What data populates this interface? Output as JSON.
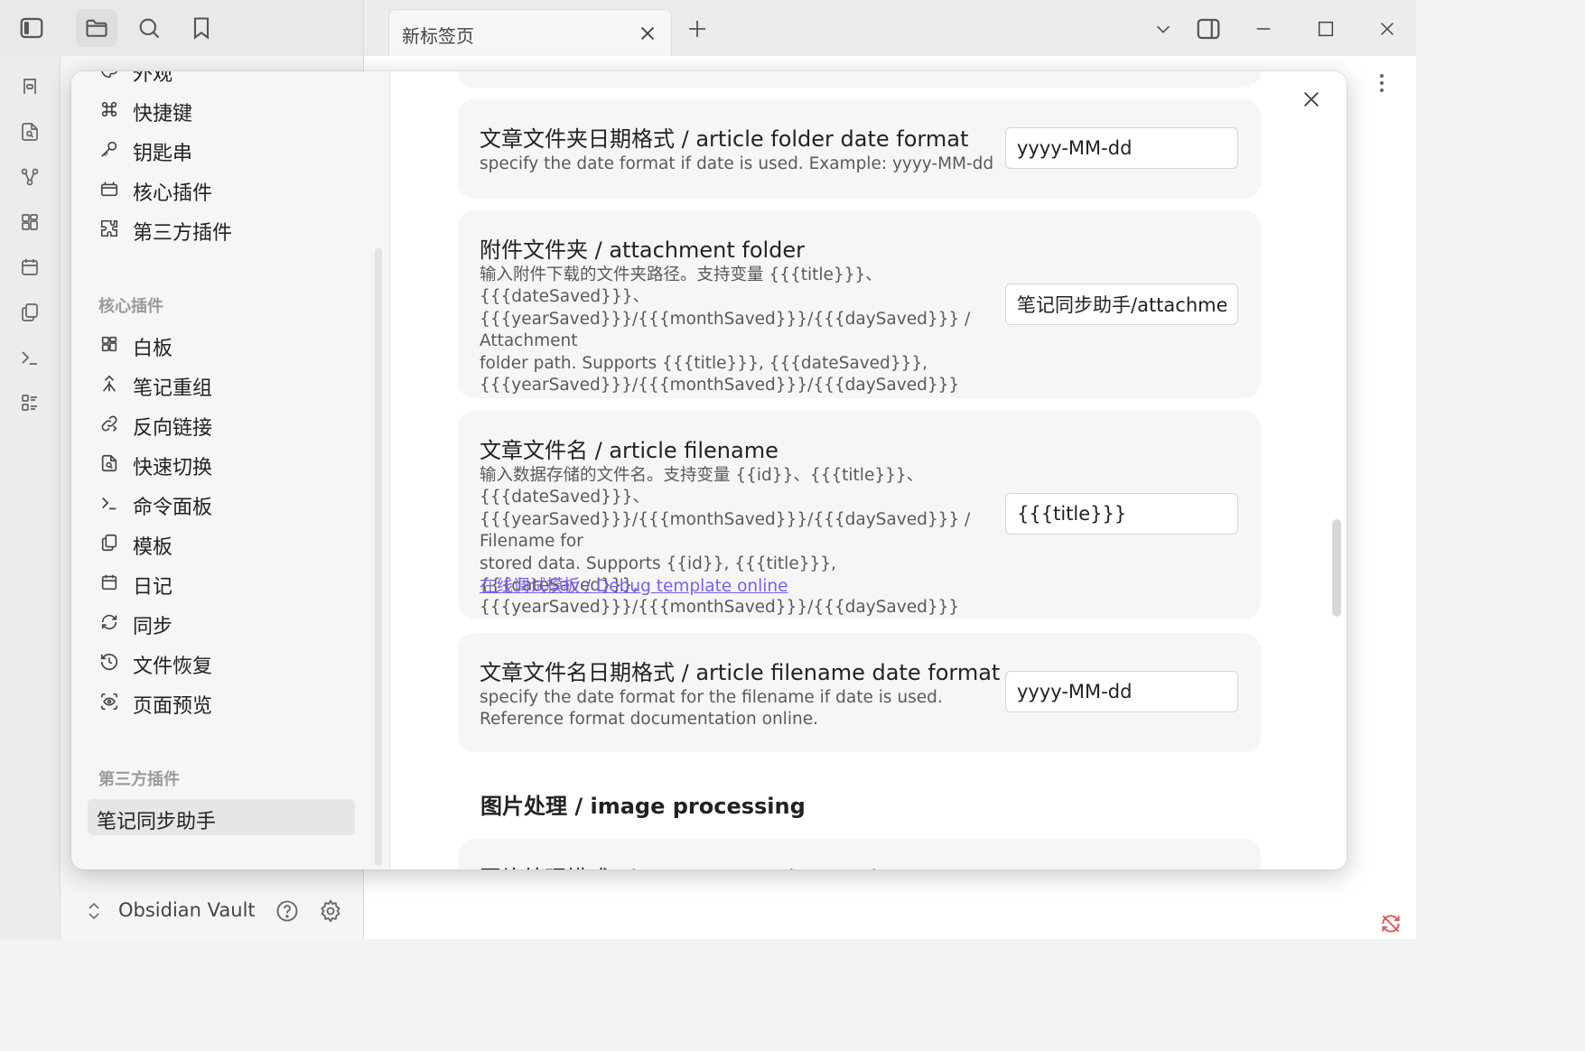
{
  "titlebar": {
    "tab_title": "新标签页"
  },
  "vault": {
    "name": "Obsidian Vault"
  },
  "settings_nav": {
    "top_items": [
      {
        "label": "外观",
        "icon": "palette-icon"
      },
      {
        "label": "快捷键",
        "icon": "command-icon"
      },
      {
        "label": "钥匙串",
        "icon": "key-icon"
      },
      {
        "label": "核心插件",
        "icon": "plug-icon"
      },
      {
        "label": "第三方插件",
        "icon": "puzzle-icon"
      }
    ],
    "core_heading": "核心插件",
    "core_items": [
      {
        "label": "白板",
        "icon": "canvas-icon"
      },
      {
        "label": "笔记重组",
        "icon": "merge-icon"
      },
      {
        "label": "反向链接",
        "icon": "backlink-icon"
      },
      {
        "label": "快速切换",
        "icon": "file-search-icon"
      },
      {
        "label": "命令面板",
        "icon": "terminal-icon"
      },
      {
        "label": "模板",
        "icon": "copy-icon"
      },
      {
        "label": "日记",
        "icon": "calendar-icon"
      },
      {
        "label": "同步",
        "icon": "refresh-icon"
      },
      {
        "label": "文件恢复",
        "icon": "history-icon"
      },
      {
        "label": "页面预览",
        "icon": "eye-scan-icon"
      }
    ],
    "community_heading": "第三方插件",
    "community_items": [
      {
        "label": "笔记同步助手",
        "active": true
      }
    ]
  },
  "settings": {
    "folder_date_format": {
      "title": "文章文件夹日期格式 / article folder date format",
      "desc": "specify the date format if date is used. Example: yyyy-MM-dd",
      "value": "yyyy-MM-dd"
    },
    "attachment_folder": {
      "title": "附件文件夹 / attachment folder",
      "desc_lines": [
        "输入附件下载的文件夹路径。支持变量 {{{title}}}、",
        "{{{dateSaved}}}、",
        "{{{yearSaved}}}/{{{monthSaved}}}/{{{daySaved}}} / Attachment",
        "folder path. Supports {{{title}}}, {{{dateSaved}}},",
        "{{{yearSaved}}}/{{{monthSaved}}}/{{{daySaved}}}"
      ],
      "value": "笔记同步助手/attachments"
    },
    "filename": {
      "title": "文章文件名 / article filename",
      "desc_lines": [
        "输入数据存储的文件名。支持变量 {{id}}、{{{title}}}、",
        "{{{dateSaved}}}、",
        "{{{yearSaved}}}/{{{monthSaved}}}/{{{daySaved}}} / Filename for",
        "stored data. Supports {{id}}, {{{title}}}, {{{dateSaved}}},",
        "{{{yearSaved}}}/{{{monthSaved}}}/{{{daySaved}}}"
      ],
      "link": "在线调试模板 / Debug template online",
      "value": "{{{title}}}"
    },
    "filename_date_format": {
      "title": "文章文件名日期格式 / article filename date format",
      "desc_lines": [
        "specify the date format for the filename if date is used.",
        "Reference format documentation online."
      ],
      "value": "yyyy-MM-dd"
    },
    "image_section_heading": "图片处理 / image processing",
    "partial_next_title": "图片处理模式 / image processing mode"
  }
}
